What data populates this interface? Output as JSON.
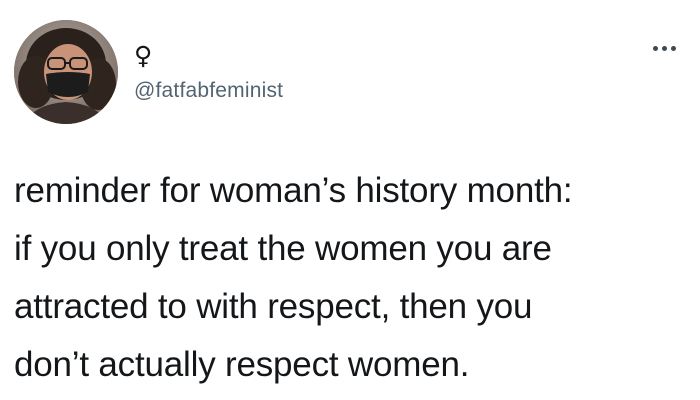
{
  "tweet": {
    "display_name": "♀",
    "handle": "@fatfabfeminist",
    "more_icon": "ellipsis-icon",
    "avatar_icon": "profile-photo",
    "body_lines": [
      "reminder for woman’s history month:",
      "if you only treat the women you are",
      "attracted to with respect, then you",
      "don’t actually respect women."
    ]
  },
  "colors": {
    "text": "#14171a",
    "secondary_text": "#536471",
    "background": "#ffffff"
  }
}
